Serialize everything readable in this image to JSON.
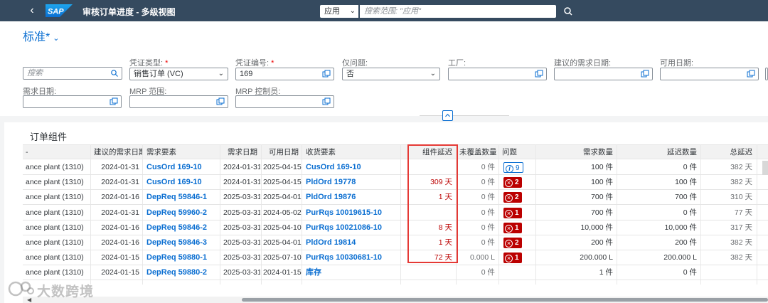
{
  "shell": {
    "logo": "SAP",
    "title": "审核订单进度 - 多级视图",
    "scope_value": "应用",
    "search_placeholder": "搜索范围: \"应用\""
  },
  "variant": {
    "name": "标准",
    "modified_marker": "*"
  },
  "filters": {
    "search_placeholder": "搜索",
    "doc_type": {
      "label": "凭证类型:",
      "value": "销售订单 (VC)"
    },
    "doc_number": {
      "label": "凭证编号:",
      "value": "169"
    },
    "issues_only": {
      "label": "仅问题:",
      "value": "否"
    },
    "plant": {
      "label": "工厂:",
      "value": ""
    },
    "proposed_req_date": {
      "label": "建议的需求日期:",
      "value": ""
    },
    "avail_date": {
      "label": "可用日期:",
      "value": ""
    },
    "req_date": {
      "label": "需求日期:",
      "value": ""
    },
    "mrp_area": {
      "label": "MRP 范围:",
      "value": ""
    },
    "mrp_controller": {
      "label": "MRP 控制员:",
      "value": ""
    },
    "required_marker": "*"
  },
  "table": {
    "title": "订单组件",
    "columns": {
      "plant": "-",
      "proposed_date": "建议的需求日期",
      "req_element": "需求要素",
      "req_date": "需求日期",
      "avail_date": "可用日期",
      "receipt_element": "收货要素",
      "comp_delay": "组件延迟",
      "uncovered_qty": "未覆盖数量",
      "issues": "问题",
      "req_qty": "需求数量",
      "delayed_qty": "延迟数量",
      "total_delay": "总延迟"
    },
    "rows": [
      {
        "plant": "ance plant (1310)",
        "proposed_date": "2024-01-31",
        "req_element": "CusOrd 169-10",
        "req_date": "2024-01-31",
        "avail_date": "2025-04-15",
        "receipt_element": "CusOrd 169-10",
        "comp_delay": "",
        "uncovered_qty": "0 件",
        "issue_type": "info",
        "issue_count": "9",
        "req_qty": "100 件",
        "delayed_qty": "0 件",
        "total_delay": "382 天"
      },
      {
        "plant": "ance plant (1310)",
        "proposed_date": "2024-01-31",
        "req_element": "CusOrd 169-10",
        "req_date": "2024-01-31",
        "avail_date": "2025-04-15",
        "receipt_element": "PldOrd 19778",
        "comp_delay": "309 天",
        "uncovered_qty": "0 件",
        "issue_type": "error",
        "issue_count": "2",
        "req_qty": "100 件",
        "delayed_qty": "100 件",
        "total_delay": "382 天"
      },
      {
        "plant": "ance plant (1310)",
        "proposed_date": "2024-01-16",
        "req_element": "DepReq 59846-1",
        "req_date": "2025-03-31",
        "avail_date": "2025-04-01",
        "receipt_element": "PldOrd 19876",
        "comp_delay": "1 天",
        "uncovered_qty": "0 件",
        "issue_type": "error",
        "issue_count": "2",
        "req_qty": "700 件",
        "delayed_qty": "700 件",
        "total_delay": "310 天"
      },
      {
        "plant": "ance plant (1310)",
        "proposed_date": "2024-01-31",
        "req_element": "DepReq 59960-2",
        "req_date": "2025-03-31",
        "avail_date": "2024-05-02",
        "receipt_element": "PurRqs 10019615-10",
        "comp_delay": "",
        "uncovered_qty": "0 件",
        "issue_type": "error",
        "issue_count": "1",
        "req_qty": "700 件",
        "delayed_qty": "0 件",
        "total_delay": "77 天"
      },
      {
        "plant": "ance plant (1310)",
        "proposed_date": "2024-01-16",
        "req_element": "DepReq 59846-2",
        "req_date": "2025-03-31",
        "avail_date": "2025-04-10",
        "receipt_element": "PurRqs 10021086-10",
        "comp_delay": "8 天",
        "uncovered_qty": "0 件",
        "issue_type": "error",
        "issue_count": "1",
        "req_qty": "10,000 件",
        "delayed_qty": "10,000 件",
        "total_delay": "317 天"
      },
      {
        "plant": "ance plant (1310)",
        "proposed_date": "2024-01-16",
        "req_element": "DepReq 59846-3",
        "req_date": "2025-03-31",
        "avail_date": "2025-04-01",
        "receipt_element": "PldOrd 19814",
        "comp_delay": "1 天",
        "uncovered_qty": "0 件",
        "issue_type": "error",
        "issue_count": "2",
        "req_qty": "200 件",
        "delayed_qty": "200 件",
        "total_delay": "382 天"
      },
      {
        "plant": "ance plant (1310)",
        "proposed_date": "2024-01-15",
        "req_element": "DepReq 59880-1",
        "req_date": "2025-03-31",
        "avail_date": "2025-07-10",
        "receipt_element": "PurRqs 10030681-10",
        "comp_delay": "72 天",
        "uncovered_qty": "0.000 L",
        "issue_type": "error",
        "issue_count": "1",
        "req_qty": "200.000 L",
        "delayed_qty": "200.000 L",
        "total_delay": "382 天"
      },
      {
        "plant": "ance plant (1310)",
        "proposed_date": "2024-01-15",
        "req_element": "DepReq 59880-2",
        "req_date": "2025-03-31",
        "avail_date": "2024-01-15",
        "receipt_element": "库存",
        "comp_delay": "",
        "uncovered_qty": "0 件",
        "issue_type": "none",
        "issue_count": "",
        "req_qty": "1 件",
        "delayed_qty": "0 件",
        "total_delay": ""
      }
    ]
  },
  "watermark": "大数跨境",
  "colors": {
    "shell": "#354a5f",
    "link": "#0a6ed1",
    "error": "#bb0000",
    "highlight": "#e53935"
  }
}
